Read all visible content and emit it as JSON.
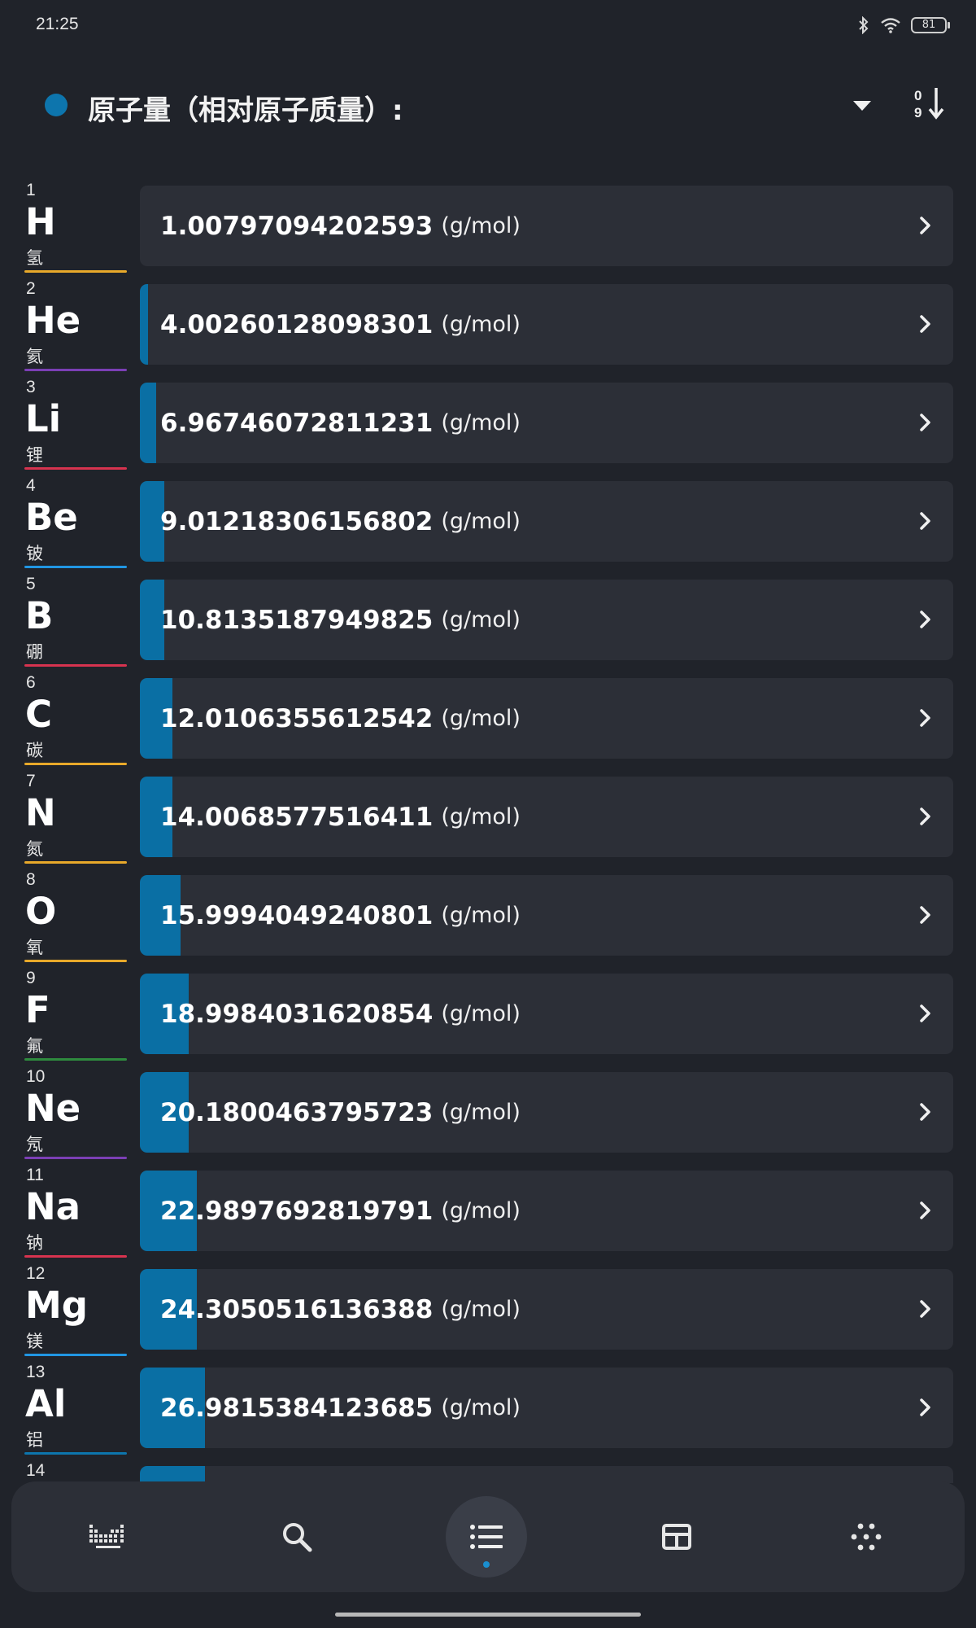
{
  "status_bar": {
    "time": "21:25",
    "battery": "81"
  },
  "header": {
    "title": "原子量（相对原子质量）:",
    "accent_color": "#0d75ad"
  },
  "unit": "(g/mol)",
  "elements": [
    {
      "number": "1",
      "symbol": "H",
      "name": "氢",
      "value": "1.00797094202593",
      "fill": 0.0,
      "line_color": "#e8a92a"
    },
    {
      "number": "2",
      "symbol": "He",
      "name": "氦",
      "value": "4.00260128098301",
      "fill": 0.01,
      "line_color": "#7b3fb5"
    },
    {
      "number": "3",
      "symbol": "Li",
      "name": "锂",
      "value": "6.96746072811231",
      "fill": 0.02,
      "line_color": "#d7334f"
    },
    {
      "number": "4",
      "symbol": "Be",
      "name": "铍",
      "value": "9.01218306156802",
      "fill": 0.03,
      "line_color": "#2196e3"
    },
    {
      "number": "5",
      "symbol": "B",
      "name": "硼",
      "value": "10.8135187949825",
      "fill": 0.03,
      "line_color": "#d7334f"
    },
    {
      "number": "6",
      "symbol": "C",
      "name": "碳",
      "value": "12.0106355612542",
      "fill": 0.04,
      "line_color": "#e8a92a"
    },
    {
      "number": "7",
      "symbol": "N",
      "name": "氮",
      "value": "14.0068577516411",
      "fill": 0.04,
      "line_color": "#e8a92a"
    },
    {
      "number": "8",
      "symbol": "O",
      "name": "氧",
      "value": "15.9994049240801",
      "fill": 0.05,
      "line_color": "#e8a92a"
    },
    {
      "number": "9",
      "symbol": "F",
      "name": "氟",
      "value": "18.9984031620854",
      "fill": 0.06,
      "line_color": "#2e8b3e"
    },
    {
      "number": "10",
      "symbol": "Ne",
      "name": "氖",
      "value": "20.1800463795723",
      "fill": 0.06,
      "line_color": "#7b3fb5"
    },
    {
      "number": "11",
      "symbol": "Na",
      "name": "钠",
      "value": "22.9897692819791",
      "fill": 0.07,
      "line_color": "#d7334f"
    },
    {
      "number": "12",
      "symbol": "Mg",
      "name": "镁",
      "value": "24.3050516136388",
      "fill": 0.07,
      "line_color": "#2196e3"
    },
    {
      "number": "13",
      "symbol": "Al",
      "name": "铝",
      "value": "26.9815384123685",
      "fill": 0.08,
      "line_color": "#0d75ad"
    },
    {
      "number": "14",
      "symbol": "",
      "name": "",
      "value": "",
      "fill": 0.08,
      "line_color": "#0d75ad"
    }
  ],
  "nav": [
    {
      "icon": "periodic-table-icon",
      "active": false
    },
    {
      "icon": "search-icon",
      "active": false
    },
    {
      "icon": "list-icon",
      "active": true
    },
    {
      "icon": "table-grid-icon",
      "active": false
    },
    {
      "icon": "dots-pattern-icon",
      "active": false
    }
  ]
}
